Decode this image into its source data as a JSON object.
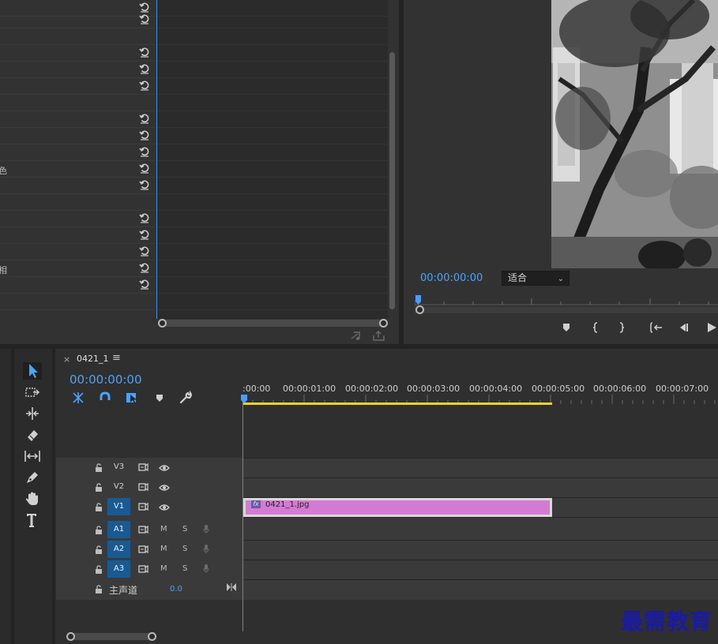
{
  "effect_controls": {
    "partial_labels": [
      "",
      "",
      "",
      "",
      "",
      "",
      "",
      "",
      "",
      "",
      "色",
      "",
      "",
      "",
      "",
      "",
      "相",
      "",
      ""
    ],
    "reset_icon": "reset-icon"
  },
  "program_monitor": {
    "timecode": "00:00:00:00",
    "fit_value": "适合",
    "chevron": "⌄",
    "controls": [
      "marker-icon",
      "mark-in-icon",
      "mark-out-icon",
      "go-to-in-icon",
      "step-back-icon",
      "play-icon"
    ]
  },
  "timeline": {
    "tab_close": "×",
    "sequence_name": "0421_1",
    "menu_glyph": "≡",
    "timecode": "00:00:00:00",
    "ruler_labels": [
      ":00:00",
      "00:00:01:00",
      "00:00:02:00",
      "00:00:03:00",
      "00:00:04:00",
      "00:00:05:00",
      "00:00:06:00",
      "00:00:07:00"
    ],
    "tracks": {
      "video": [
        "V3",
        "V2",
        "V1"
      ],
      "audio": [
        "A1",
        "A2",
        "A3"
      ],
      "mute": "M",
      "solo": "S"
    },
    "master": {
      "label": "主声道",
      "value": "0.0"
    },
    "clip": {
      "name": "0421_1.jpg",
      "fx": "fx"
    }
  },
  "watermark": "最需教育",
  "colors": {
    "accent_blue": "#4aa3ff",
    "clip_pink": "#d37bd3",
    "work_area_yellow": "#e8d61e",
    "track_active": "#1a5a93"
  }
}
